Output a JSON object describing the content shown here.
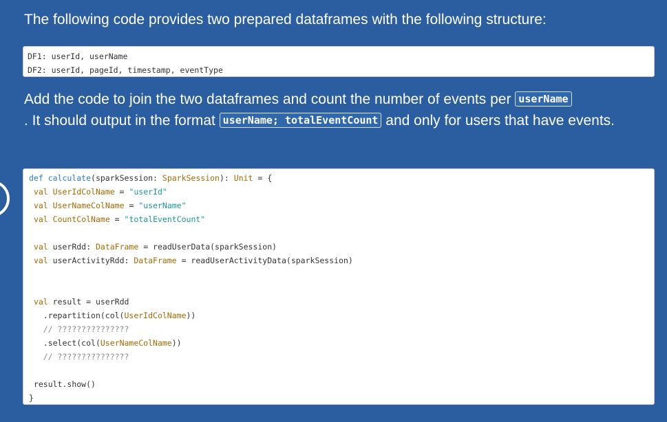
{
  "question": {
    "heading": "The following code provides two prepared dataframes with the following structure:",
    "schema_lines": [
      "DF1: userId, userName",
      "DF2: userId, pageId, timestamp, eventType"
    ],
    "instructions": {
      "part1": "Add the code to join the two dataframes and count the number of events per ",
      "code1": "userName",
      "part2": ". It should output in the format ",
      "code2": "userName; totalEventCount",
      "part3": " and only for users that have events."
    }
  },
  "code": {
    "l1_kw": "def",
    "l1_fn": "calculate",
    "l1_a": "(sparkSession: ",
    "l1_type": "SparkSession",
    "l1_b": "): ",
    "l1_ret": "Unit",
    "l1_c": " = {",
    "l2_kw": "val",
    "l2_name": "UserIdColName",
    "l2_eq": " = ",
    "l2_str": "\"userId\"",
    "l3_kw": "val",
    "l3_name": "UserNameColName",
    "l3_eq": " = ",
    "l3_str": "\"userName\"",
    "l4_kw": "val",
    "l4_name": "CountColName",
    "l4_eq": " = ",
    "l4_str": "\"totalEventCount\"",
    "l6_kw": "val",
    "l6_a": " userRdd: ",
    "l6_type": "DataFrame",
    "l6_b": " = readUserData(sparkSession)",
    "l7_kw": "val",
    "l7_a": " userActivityRdd: ",
    "l7_type": "DataFrame",
    "l7_b": " = readUserActivityData(sparkSession)",
    "l10_kw": "val",
    "l10_a": " result = userRdd",
    "l11_a": ".repartition(col(",
    "l11_ref": "UserIdColName",
    "l11_b": "))",
    "l12_cm": "// ???????????????",
    "l13_a": ".select(col(",
    "l13_ref": "UserNameColName",
    "l13_b": "))",
    "l14_cm": "// ???????????????",
    "l16": "result.show()",
    "l17": "}"
  }
}
